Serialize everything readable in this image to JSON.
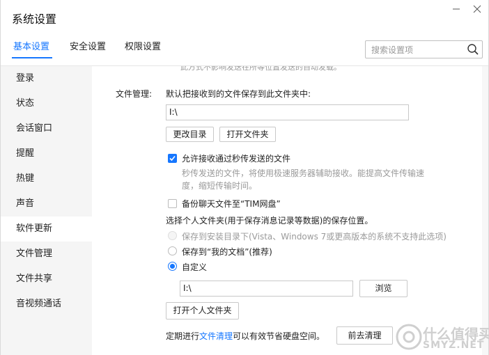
{
  "window": {
    "title": "系统设置"
  },
  "tabs": [
    {
      "label": "基本设置",
      "active": true
    },
    {
      "label": "安全设置",
      "active": false
    },
    {
      "label": "权限设置",
      "active": false
    }
  ],
  "search": {
    "placeholder": "搜索设置项"
  },
  "sidebar": {
    "items": [
      {
        "label": "登录"
      },
      {
        "label": "状态"
      },
      {
        "label": "会话窗口"
      },
      {
        "label": "提醒"
      },
      {
        "label": "热键"
      },
      {
        "label": "声音"
      },
      {
        "label": "软件更新",
        "active": true
      },
      {
        "label": "文件管理"
      },
      {
        "label": "文件共享"
      },
      {
        "label": "音视频通话"
      }
    ]
  },
  "content": {
    "clipped_top_text": "此方式不影响发送在所等位置发送的自动发载。",
    "file_section_label": "文件管理:",
    "default_save_text": "默认把接收到的文件保存到此文件夹中:",
    "default_path_value": "I:\\",
    "change_dir_button": "更改目录",
    "open_folder_button": "打开文件夹",
    "allow_instant": {
      "checked": true,
      "label": "允许接收通过秒传发送的文件",
      "desc_line1": "秒传发送的文件，将使用极速服务器辅助接收。能提高文件传输速",
      "desc_line2": "度，缩短传输时间。"
    },
    "backup": {
      "checked": false,
      "label": "备份聊天文件至“TIM网盘”"
    },
    "personal_folder_title": "选择个人文件夹(用于保存消息记录等数据)的保存位置。",
    "radio_install": "保存到安装目录下(Vista、Windows 7或更高版本的系统不支持此选项)",
    "radio_mydocs": "保存到“我的文档”(推荐)",
    "radio_custom": "自定义",
    "custom_path_value": "I:\\",
    "browse_button": "浏览",
    "open_personal_button": "打开个人文件夹",
    "cleanup_prefix": "定期进行",
    "cleanup_link": "文件清理",
    "cleanup_suffix": "可以有效节省硬盘空间。",
    "go_clean_button": "前去清理"
  },
  "watermark": {
    "text": "什么值得买",
    "site": "SMYZ.NET"
  },
  "colors": {
    "accent": "#1677ff",
    "sidebar_bg": "#f5f5f5"
  }
}
